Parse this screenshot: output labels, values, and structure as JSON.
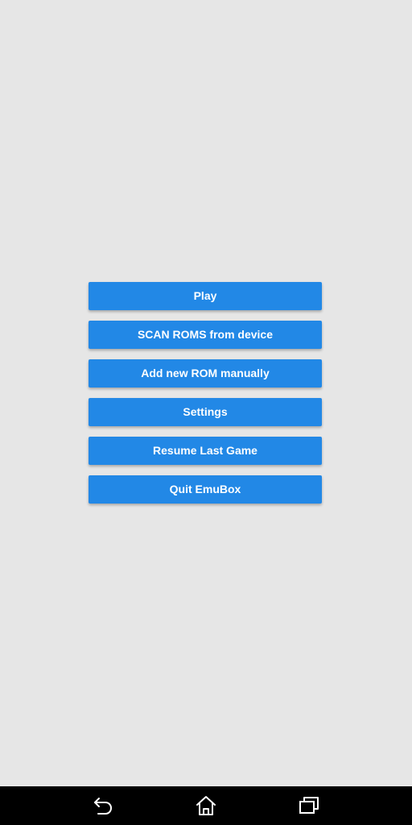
{
  "menu": {
    "buttons": [
      {
        "label": "Play"
      },
      {
        "label": "SCAN ROMS from device"
      },
      {
        "label": "Add new ROM manually"
      },
      {
        "label": "Settings"
      },
      {
        "label": "Resume Last Game"
      },
      {
        "label": "Quit EmuBox"
      }
    ]
  },
  "navbar": {
    "icons": [
      "back-icon",
      "home-icon",
      "recent-apps-icon"
    ]
  },
  "colors": {
    "background": "#e6e6e6",
    "button": "#2288e6",
    "button_text": "#ffffff",
    "navbar": "#000000"
  }
}
